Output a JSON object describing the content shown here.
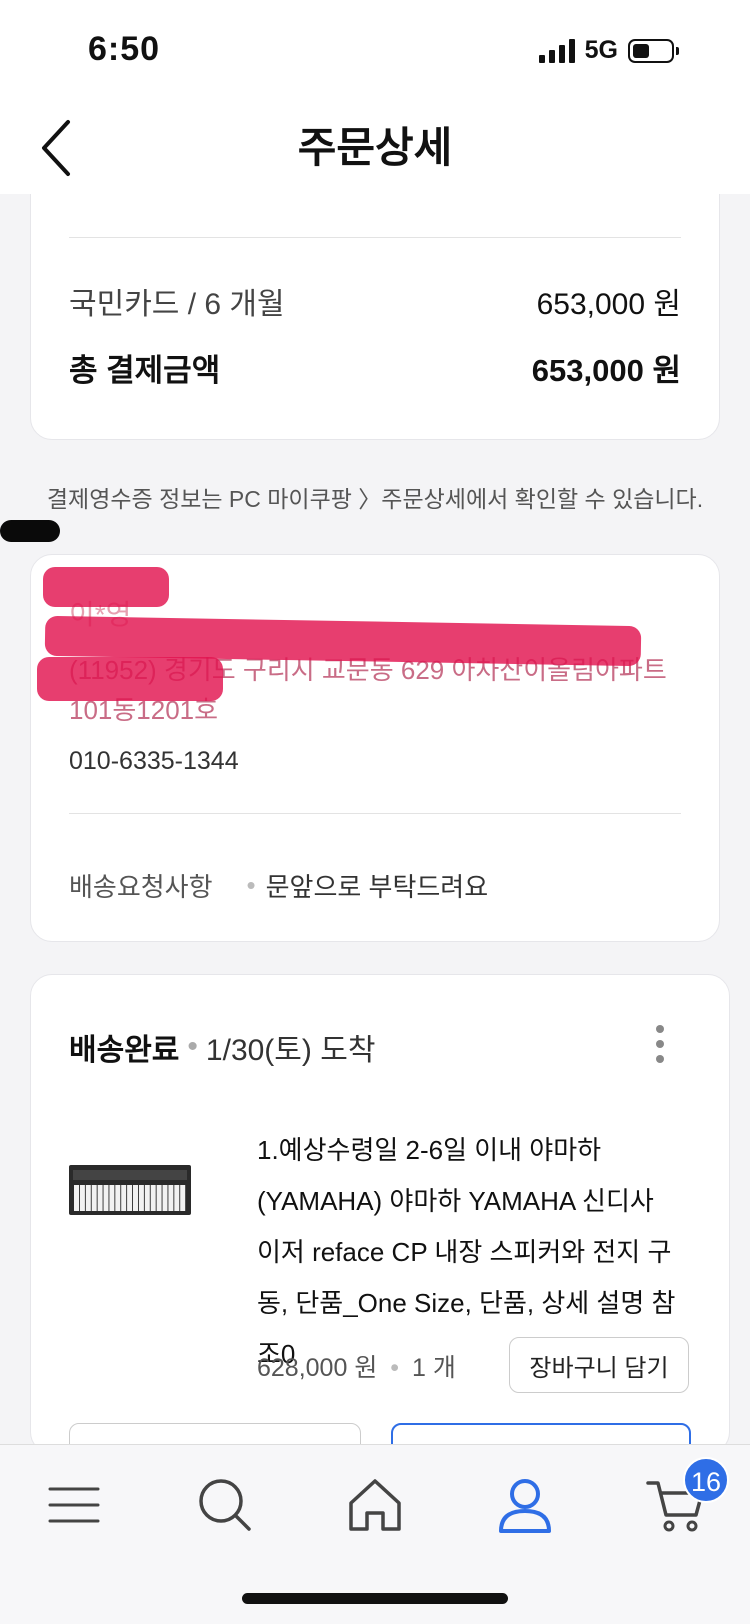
{
  "status": {
    "time": "6:50",
    "network": "5G",
    "battery_level": 0.45
  },
  "header": {
    "title": "주문상세",
    "back_icon": "chevron-left-icon"
  },
  "payment": {
    "cut_off_line": "— — —",
    "method": "국민카드 / 6 개월",
    "method_amount": "653,000 원",
    "total_label": "총 결제금액",
    "total_amount": "653,000 원"
  },
  "receipt_note": "결제영수증 정보는 PC 마이쿠팡 〉주문상세에서 확인할 수 있습니다.",
  "address": {
    "name": "이*영",
    "line1": "(11952) 경기도 구리시 교문동 629 아차산이올림아파트",
    "line2": "101동1201호",
    "phone": "010-6335-1344",
    "request_label": "배송요청사항",
    "request_value": "문앞으로 부탁드려요"
  },
  "shipment": {
    "status": "배송완료",
    "arrival": "1/30(토) 도착",
    "product": {
      "title": "1.예상수령일 2-6일 이내 야마하(YAMAHA) 야마하 YAMAHA 신디사이저 reface CP 내장 스피커와 전지 구동, 단품_One Size, 단품, 상세 설명 참조0",
      "price": "628,000 원",
      "quantity": "1 개"
    },
    "cart_button": "장바구니 담기"
  },
  "tabbar": {
    "items": [
      {
        "name": "menu-icon"
      },
      {
        "name": "search-icon"
      },
      {
        "name": "home-icon"
      },
      {
        "name": "user-icon",
        "active": true
      },
      {
        "name": "cart-icon"
      }
    ],
    "cart_count": "16",
    "accent": "#2f6ee6"
  }
}
